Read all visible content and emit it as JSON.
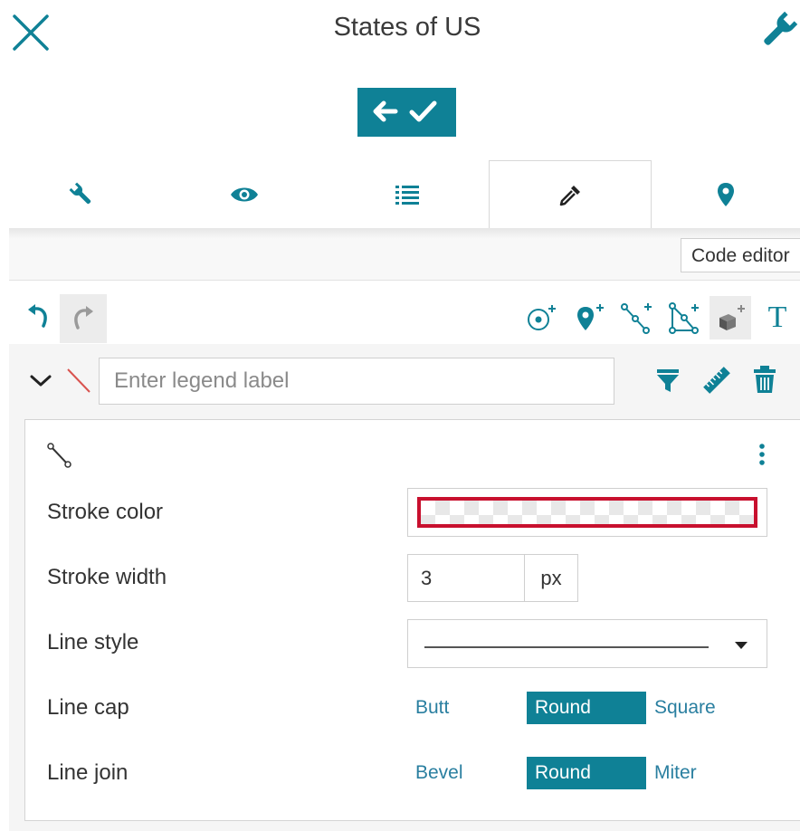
{
  "header": {
    "title": "States of US"
  },
  "tabs": [
    {
      "name": "settings",
      "icon": "wrench-icon"
    },
    {
      "name": "view",
      "icon": "eye-icon"
    },
    {
      "name": "list",
      "icon": "list-icon"
    },
    {
      "name": "style",
      "icon": "eyedropper-icon",
      "active": true
    },
    {
      "name": "location",
      "icon": "map-pin-icon"
    }
  ],
  "code_editor_label": "Code editor",
  "toolbar": {
    "tools": [
      "add-circle-icon",
      "add-point-icon",
      "add-line-icon",
      "add-polygon-icon",
      "add-3d-object-icon",
      "text-icon"
    ],
    "text_tool_glyph": "T"
  },
  "legend": {
    "placeholder": "Enter legend label",
    "value": ""
  },
  "style": {
    "stroke_color_label": "Stroke color",
    "stroke_color_value": "transparent",
    "stroke_width_label": "Stroke width",
    "stroke_width_value": "3",
    "stroke_width_unit": "px",
    "line_style_label": "Line style",
    "line_style_value": "solid",
    "line_cap_label": "Line cap",
    "line_cap_options": [
      "Butt",
      "Round",
      "Square"
    ],
    "line_cap_selected": "Round",
    "line_join_label": "Line join",
    "line_join_options": [
      "Bevel",
      "Round",
      "Miter"
    ],
    "line_join_selected": "Round"
  },
  "colors": {
    "accent": "#0f8196",
    "highlight": "#c8102e",
    "legend_line": "#d9534f"
  }
}
